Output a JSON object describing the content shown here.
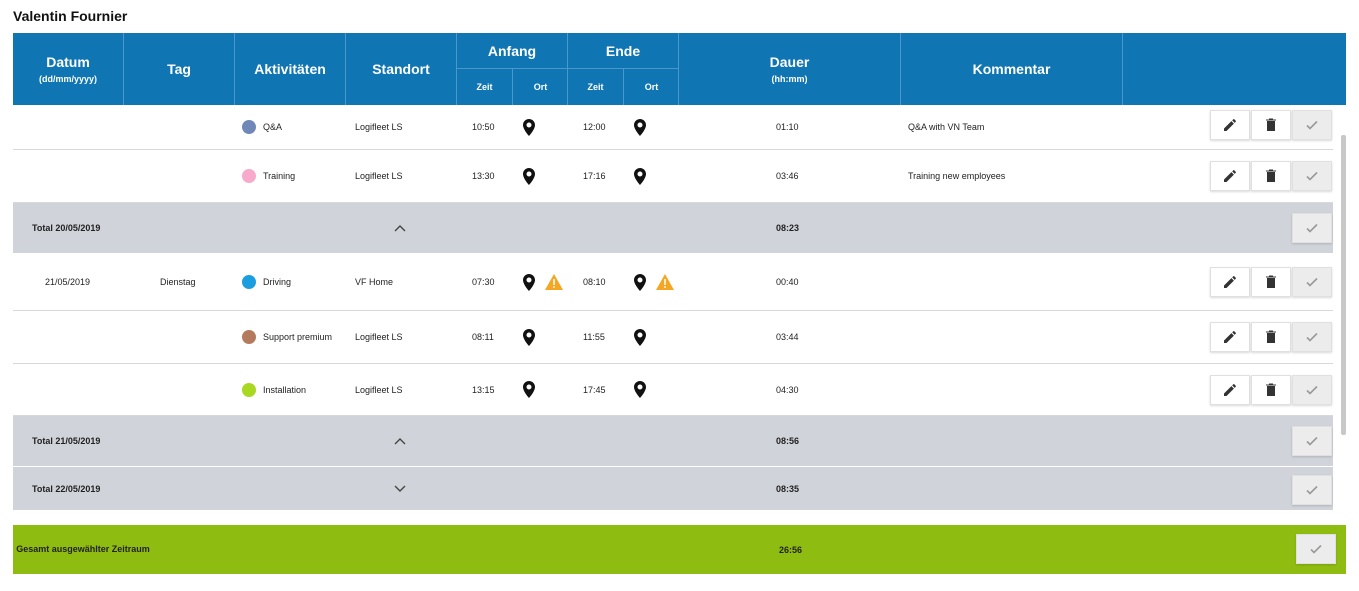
{
  "user": {
    "name": "Valentin Fournier"
  },
  "header": {
    "datum": "Datum",
    "datum_format": "(dd/mm/yyyy)",
    "tag": "Tag",
    "aktivitaeten": "Aktivitäten",
    "standort": "Standort",
    "anfang": "Anfang",
    "ende": "Ende",
    "zeit": "Zeit",
    "ort": "Ort",
    "dauer": "Dauer",
    "dauer_format": "(hh:mm)",
    "kommentar": "Kommentar"
  },
  "rows": [
    {
      "activity": "Q&A",
      "color": "#7088b8",
      "standort": "Logifleet LS",
      "start": "10:50",
      "end": "12:00",
      "dauer": "01:10",
      "kommentar": "Q&A with VN Team"
    },
    {
      "activity": "Training",
      "color": "#f7aacc",
      "standort": "Logifleet LS",
      "start": "13:30",
      "end": "17:16",
      "dauer": "03:46",
      "kommentar": "Training new employees"
    },
    {
      "total_label": "Total 20/05/2019",
      "dauer": "08:23",
      "expanded": true
    },
    {
      "datum": "21/05/2019",
      "tag": "Dienstag",
      "activity": "Driving",
      "color": "#1a9ee0",
      "standort": "VF Home",
      "start": "07:30",
      "end": "08:10",
      "dauer": "00:40",
      "warning": true
    },
    {
      "activity": "Support premium",
      "color": "#b47a5e",
      "standort": "Logifleet LS",
      "start": "08:11",
      "end": "11:55",
      "dauer": "03:44"
    },
    {
      "activity": "Installation",
      "color": "#a8d820",
      "standort": "Logifleet LS",
      "start": "13:15",
      "end": "17:45",
      "dauer": "04:30"
    },
    {
      "total_label": "Total 21/05/2019",
      "dauer": "08:56",
      "expanded": true
    },
    {
      "total_label": "Total 22/05/2019",
      "dauer": "08:35",
      "expanded": false
    }
  ],
  "grand_total": {
    "label": "Gesamt ausgewählter Zeitraum",
    "dauer": "26:56"
  },
  "icons": {
    "edit": "pencil-icon",
    "delete": "trash-icon",
    "confirm": "check-icon",
    "location": "map-pin-icon",
    "warning": "warning-icon",
    "expand": "chevron-icon"
  },
  "colors": {
    "header": "#1076b3",
    "total_row": "#d0d3da",
    "grand_total": "#8fbc10",
    "warning": "#f5a623"
  }
}
